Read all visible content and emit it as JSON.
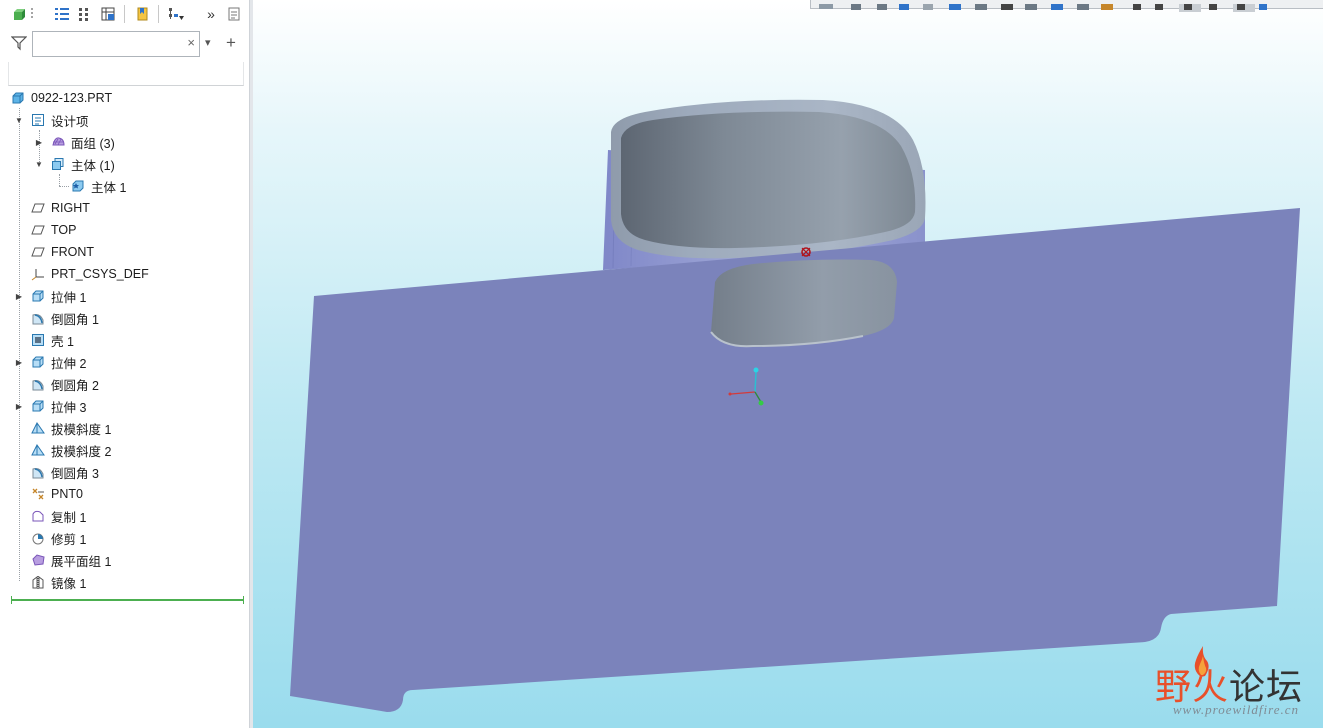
{
  "search": {
    "placeholder": "",
    "value": "",
    "clear_glyph": "×"
  },
  "toolbar": {
    "buttons": [
      "settings-icon",
      "model-tree-icon",
      "layer-tree-icon",
      "table-icon",
      "bookmark-icon",
      "tree-filter-icon",
      "more-icon",
      "notes-icon"
    ],
    "more_glyph": "»"
  },
  "filter": {
    "add_glyph": "+",
    "dropdown_glyph": "▾"
  },
  "tree": {
    "root": "0922-123.PRT",
    "items": [
      {
        "label": "设计项",
        "icon": "design-items-icon"
      },
      {
        "label": "面组 (3)",
        "icon": "quilt-icon"
      },
      {
        "label": "主体 (1)",
        "icon": "bodies-icon"
      },
      {
        "label": "主体 1",
        "icon": "body-icon"
      },
      {
        "label": "RIGHT",
        "icon": "datum-plane-icon"
      },
      {
        "label": "TOP",
        "icon": "datum-plane-icon"
      },
      {
        "label": "FRONT",
        "icon": "datum-plane-icon"
      },
      {
        "label": "PRT_CSYS_DEF",
        "icon": "csys-icon"
      },
      {
        "label": "拉伸 1",
        "icon": "extrude-icon"
      },
      {
        "label": "倒圆角 1",
        "icon": "round-icon"
      },
      {
        "label": "壳 1",
        "icon": "shell-icon"
      },
      {
        "label": "拉伸 2",
        "icon": "extrude-icon"
      },
      {
        "label": "倒圆角 2",
        "icon": "round-icon"
      },
      {
        "label": "拉伸 3",
        "icon": "extrude-icon"
      },
      {
        "label": "拔模斜度 1",
        "icon": "draft-icon"
      },
      {
        "label": "拔模斜度 2",
        "icon": "draft-icon"
      },
      {
        "label": "倒圆角 3",
        "icon": "round-icon"
      },
      {
        "label": "PNT0",
        "icon": "datum-point-icon"
      },
      {
        "label": "复制 1",
        "icon": "copy-icon"
      },
      {
        "label": "修剪 1",
        "icon": "trim-icon"
      },
      {
        "label": "展平面组 1",
        "icon": "flatten-quilt-icon"
      },
      {
        "label": "镜像 1",
        "icon": "mirror-icon"
      }
    ]
  },
  "watermark": {
    "main_a": "野火",
    "main_b": "论坛",
    "sub": "www.proewildfire.cn"
  },
  "colors": {
    "surface": "#7b83bb",
    "body": "#8a95a3",
    "accent": "#2f73c9",
    "insert_line": "#4caf50",
    "wm_red": "#e8502a",
    "wm_dark": "#333333"
  }
}
